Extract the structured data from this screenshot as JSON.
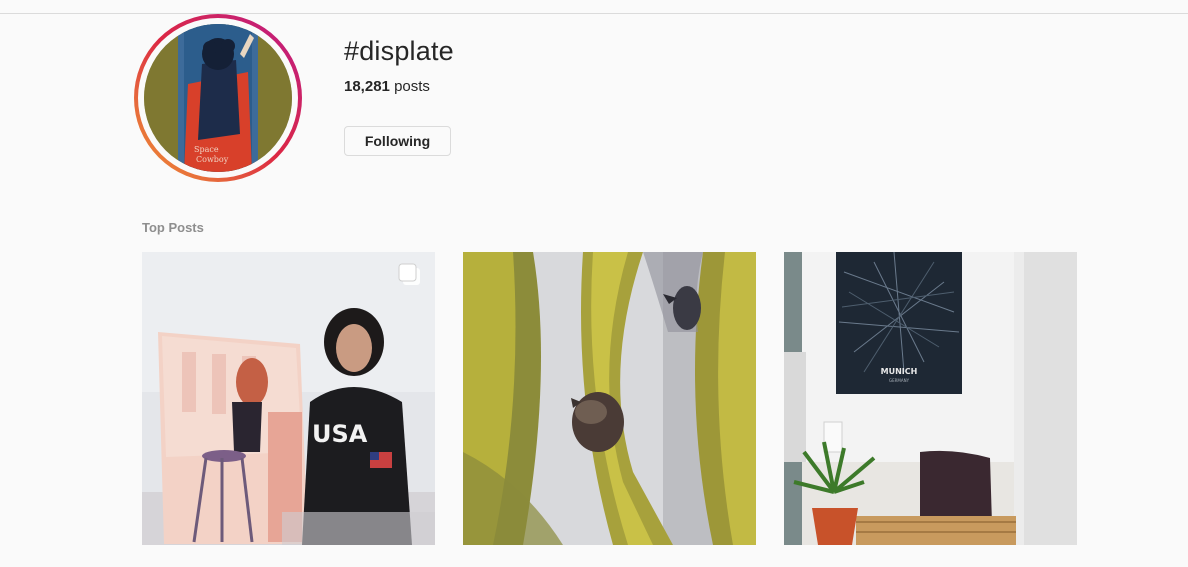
{
  "header": {
    "hashtag": "#displate",
    "posts_count": "18,281",
    "posts_label": "posts",
    "follow_button_label": "Following"
  },
  "top_posts": {
    "section_title": "Top Posts",
    "posts": [
      {
        "subject": "woman holding pin-up metal poster",
        "multiple_images": true,
        "icon": "multiple-images-icon"
      },
      {
        "subject": "birds on yellow branches painting",
        "multiple_images": false
      },
      {
        "subject": "Munich map poster above plant and pillow",
        "multiple_images": false,
        "poster_text": "MUNICH",
        "poster_subtext": "GERMANY"
      }
    ]
  },
  "colors": {
    "background": "#fafafa",
    "text": "#262626",
    "muted": "#8e8e8e",
    "border": "#dbdbdb"
  }
}
